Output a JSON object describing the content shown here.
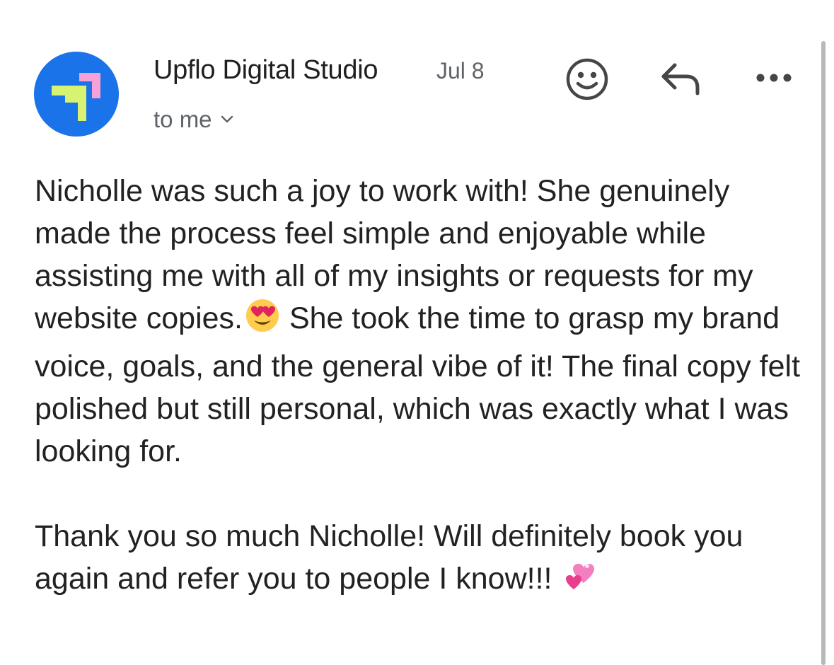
{
  "email": {
    "sender_name": "Upflo Digital Studio",
    "date": "Jul 8",
    "recipient_label": "to me",
    "avatar_icon": "upflo-logo-icon",
    "avatar_bg": "#1a73e8"
  },
  "toolbar": {
    "react_icon": "smiley-face-icon",
    "reply_icon": "reply-arrow-icon",
    "more_icon": "more-horizontal-icon"
  },
  "body": {
    "paragraph1": "Nicholle was such a joy to work with! She genuinely made the process feel simple and enjoyable while assisting me with all of my insights or requests for my website copies.",
    "paragraph1_emoji": "heart-eyes-emoji",
    "paragraph1_cont": "She took the time to grasp my brand voice, goals, and the general vibe of it! The final copy felt polished but still personal, which was exactly what I was looking for.",
    "paragraph2": "Thank you so much Nicholle! Will definitely book you again and refer you to people I know!!!",
    "paragraph2_emoji": "revolving-hearts-emoji"
  }
}
